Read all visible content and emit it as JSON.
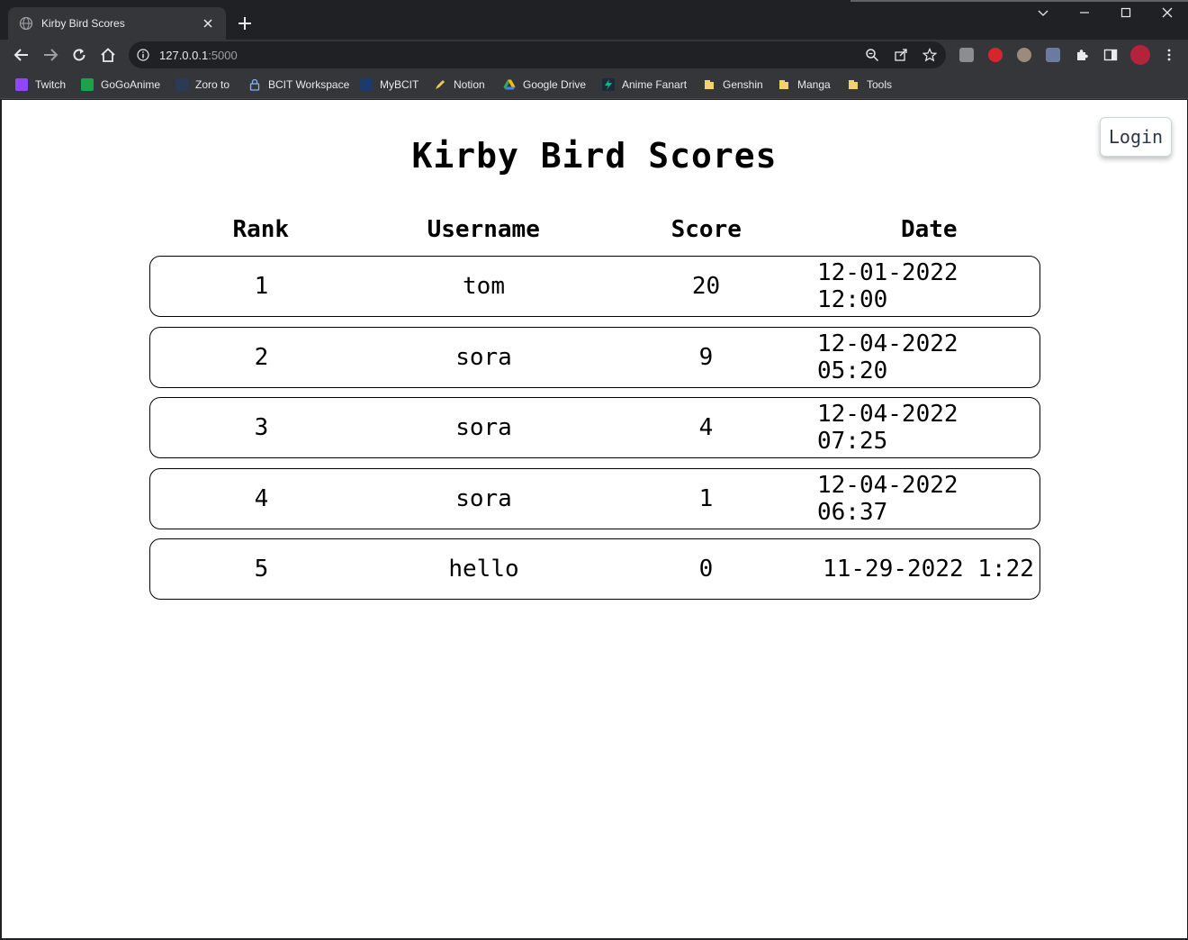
{
  "browser": {
    "tab_title": "Kirby Bird Scores",
    "url_host": "127.0.0.1",
    "url_port": ":5000",
    "bookmarks": [
      {
        "label": "Twitch",
        "icon": "twitch-icon",
        "color": "#9146ff"
      },
      {
        "label": "GoGoAnime",
        "icon": "gogoanime-icon",
        "color": "#1aa34a"
      },
      {
        "label": "Zoro to",
        "icon": "zoro-icon",
        "color": "#2b3a55"
      },
      {
        "label": "BCIT Workspace",
        "icon": "lock-icon",
        "color": "#4a6fd8"
      },
      {
        "label": "MyBCIT",
        "icon": "mybcit-icon",
        "color": "#1c3a6b"
      },
      {
        "label": "Notion",
        "icon": "pencil-icon",
        "color": "#f2c94c"
      },
      {
        "label": "Google Drive",
        "icon": "google-drive-icon",
        "color": "#34a853"
      },
      {
        "label": "Anime Fanart",
        "icon": "fanart-icon",
        "color": "#10b981"
      },
      {
        "label": "Genshin",
        "icon": "folder-icon",
        "color": "#f6d16b"
      },
      {
        "label": "Manga",
        "icon": "folder-icon",
        "color": "#f6d16b"
      },
      {
        "label": "Tools",
        "icon": "folder-icon",
        "color": "#f6d16b"
      }
    ]
  },
  "page": {
    "login_label": "Login",
    "title": "Kirby Bird Scores",
    "columns": [
      "Rank",
      "Username",
      "Score",
      "Date"
    ],
    "rows": [
      {
        "rank": "1",
        "username": "tom",
        "score": "20",
        "date": "12-01-2022 12:00"
      },
      {
        "rank": "2",
        "username": "sora",
        "score": "9",
        "date": "12-04-2022 05:20"
      },
      {
        "rank": "3",
        "username": "sora",
        "score": "4",
        "date": "12-04-2022 07:25"
      },
      {
        "rank": "4",
        "username": "sora",
        "score": "1",
        "date": "12-04-2022 06:37"
      },
      {
        "rank": "5",
        "username": "hello",
        "score": "0",
        "date": "11-29-2022 1:22"
      }
    ]
  }
}
